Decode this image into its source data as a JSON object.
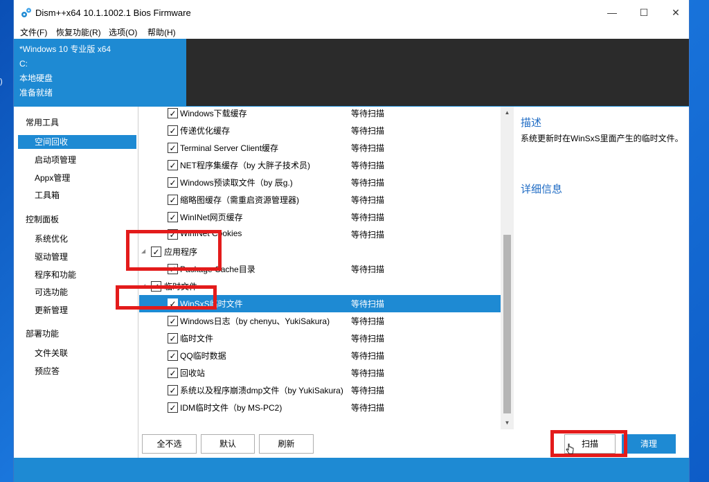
{
  "window": {
    "title": "Dism++x64 10.1.1002.1 Bios Firmware",
    "controls": {
      "minimize": "—",
      "maximize": "☐",
      "close": "✕"
    }
  },
  "menu": [
    "文件(F)",
    "恢复功能(R)",
    "选项(O)",
    "帮助(H)"
  ],
  "image_info": [
    "*Windows 10 专业版 x64",
    "C:",
    "本地硬盘",
    "准备就绪"
  ],
  "sidebar": {
    "categories": [
      {
        "title": "常用工具",
        "items": [
          "空间回收",
          "启动项管理",
          "Appx管理",
          "工具箱"
        ]
      },
      {
        "title": "控制面板",
        "items": [
          "系统优化",
          "驱动管理",
          "程序和功能",
          "可选功能",
          "更新管理"
        ]
      },
      {
        "title": "部署功能",
        "items": [
          "文件关联",
          "预应答"
        ]
      }
    ],
    "selected": "空间回收"
  },
  "list": {
    "rows": [
      {
        "type": "item",
        "label": "Windows下载缓存",
        "status": "等待扫描",
        "checked": true
      },
      {
        "type": "item",
        "label": "传递优化缓存",
        "status": "等待扫描",
        "checked": true
      },
      {
        "type": "item",
        "label": "Terminal Server Client缓存",
        "status": "等待扫描",
        "checked": true
      },
      {
        "type": "item",
        "label": "NET程序集缓存（by 大胖子技术员)",
        "status": "等待扫描",
        "checked": true
      },
      {
        "type": "item",
        "label": "Windows预读取文件（by 辰g.)",
        "status": "等待扫描",
        "checked": true
      },
      {
        "type": "item",
        "label": "缩略图缓存（需重启资源管理器)",
        "status": "等待扫描",
        "checked": true
      },
      {
        "type": "item",
        "label": "WinINet网页缓存",
        "status": "等待扫描",
        "checked": true
      },
      {
        "type": "item",
        "label": "WinINet Cookies",
        "status": "等待扫描",
        "checked": true
      },
      {
        "type": "group",
        "label": "应用程序",
        "status": "",
        "checked": true
      },
      {
        "type": "item",
        "label": "Package Cache目录",
        "status": "等待扫描",
        "checked": true
      },
      {
        "type": "group",
        "label": "临时文件",
        "status": "",
        "checked": true
      },
      {
        "type": "item",
        "label": "WinSxS临时文件",
        "status": "等待扫描",
        "checked": true,
        "selected": true
      },
      {
        "type": "item",
        "label": "Windows日志（by chenyu、YukiSakura)",
        "status": "等待扫描",
        "checked": true
      },
      {
        "type": "item",
        "label": "临时文件",
        "status": "等待扫描",
        "checked": true
      },
      {
        "type": "item",
        "label": "QQ临时数据",
        "status": "等待扫描",
        "checked": true
      },
      {
        "type": "item",
        "label": "回收站",
        "status": "等待扫描",
        "checked": true
      },
      {
        "type": "item",
        "label": "系统以及程序崩溃dmp文件（by YukiSakura)",
        "status": "等待扫描",
        "checked": true
      },
      {
        "type": "item",
        "label": "IDM临时文件（by MS-PC2)",
        "status": "等待扫描",
        "checked": true
      }
    ]
  },
  "description": {
    "title": "描述",
    "text": "系统更新时在WinSxS里面产生的临时文件。",
    "detail_title": "详细信息"
  },
  "buttons": {
    "deselect_all": "全不选",
    "default": "默认",
    "refresh": "刷新",
    "scan": "扫描",
    "clean": "清理"
  },
  "icons": {
    "check": "✓",
    "expand": "◢",
    "scroll_up": "▲",
    "scroll_down": "▼"
  },
  "colors": {
    "accent": "#1e8ad3",
    "highlight": "#e31b1b",
    "dark_panel": "#2b2b2b"
  }
}
